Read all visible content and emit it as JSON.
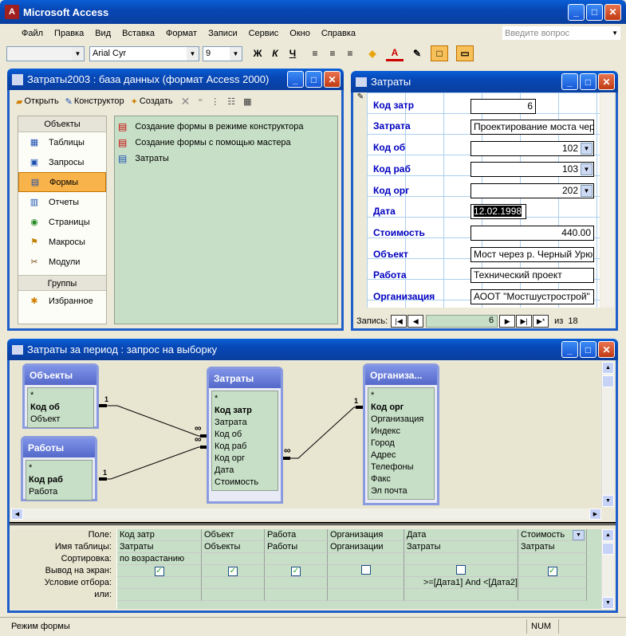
{
  "app": {
    "title": "Microsoft Access",
    "help_placeholder": "Введите вопрос",
    "status": "Режим формы",
    "num": "NUM"
  },
  "menu": [
    "Файл",
    "Правка",
    "Вид",
    "Вставка",
    "Формат",
    "Записи",
    "Сервис",
    "Окно",
    "Справка"
  ],
  "toolbar": {
    "font": "Arial Cyr",
    "size": "9"
  },
  "dbwin": {
    "title": "Затраты2003 : база данных (формат Access 2000)",
    "buttons": {
      "open": "Открыть",
      "design": "Конструктор",
      "create": "Создать"
    },
    "objects_header": "Объекты",
    "objects": [
      "Таблицы",
      "Запросы",
      "Формы",
      "Отчеты",
      "Страницы",
      "Макросы",
      "Модули"
    ],
    "groups_header": "Группы",
    "favorites": "Избранное",
    "items": [
      "Создание формы в режиме конструктора",
      "Создание формы с помощью мастера",
      "Затраты"
    ]
  },
  "form": {
    "title": "Затраты",
    "fields": [
      {
        "label": "Код затр",
        "value": "6",
        "num": true,
        "dd": false
      },
      {
        "label": "Затрата",
        "value": "Проектирование моста чер",
        "num": false,
        "dd": false
      },
      {
        "label": "Код об",
        "value": "102",
        "num": true,
        "dd": true
      },
      {
        "label": "Код раб",
        "value": "103",
        "num": true,
        "dd": true
      },
      {
        "label": "Код орг",
        "value": "202",
        "num": true,
        "dd": true
      },
      {
        "label": "Дата",
        "value": "12.02.1998",
        "num": false,
        "dd": false
      },
      {
        "label": "Стоимость",
        "value": "440.00",
        "num": true,
        "dd": false
      },
      {
        "label": "Объект",
        "value": "Мост через р. Черный Урю",
        "num": false,
        "dd": false
      },
      {
        "label": "Работа",
        "value": "Технический проект",
        "num": false,
        "dd": false
      },
      {
        "label": "Организация",
        "value": "АООТ \"Мостшустрострой\"",
        "num": false,
        "dd": false
      }
    ],
    "record_label": "Запись:",
    "record_current": "6",
    "record_of": "из",
    "record_total": "18"
  },
  "query": {
    "title": "Затраты за период : запрос на выборку",
    "tables": [
      {
        "name": "Объекты",
        "fields": [
          "*",
          "Код об",
          "Объект"
        ],
        "bold": "Код об"
      },
      {
        "name": "Работы",
        "fields": [
          "*",
          "Код раб",
          "Работа"
        ],
        "bold": "Код раб"
      },
      {
        "name": "Затраты",
        "fields": [
          "*",
          "Код затр",
          "Затрата",
          "Код об",
          "Код раб",
          "Код орг",
          "Дата",
          "Стоимость"
        ],
        "bold": "Код затр"
      },
      {
        "name": "Организа...",
        "fields": [
          "*",
          "Код орг",
          "Организация",
          "Индекс",
          "Город",
          "Адрес",
          "Телефоны",
          "Факс",
          "Эл почта"
        ],
        "bold": "Код орг"
      }
    ],
    "rel_one": "1",
    "rel_many": "∞",
    "row_labels": [
      "Поле:",
      "Имя таблицы:",
      "Сортировка:",
      "Вывод на экран:",
      "Условие отбора:",
      "или:"
    ],
    "columns": [
      {
        "field": "Код затр",
        "table": "Затраты",
        "sort": "по возрастанию",
        "show": true,
        "cond": ""
      },
      {
        "field": "Объект",
        "table": "Объекты",
        "sort": "",
        "show": true,
        "cond": ""
      },
      {
        "field": "Работа",
        "table": "Работы",
        "sort": "",
        "show": true,
        "cond": ""
      },
      {
        "field": "Организация",
        "table": "Организации",
        "sort": "",
        "show": false,
        "cond": ""
      },
      {
        "field": "Дата",
        "table": "Затраты",
        "sort": "",
        "show": false,
        "cond": ">=[Дата1] And <[Дата2]"
      },
      {
        "field": "Стоимость",
        "table": "Затраты",
        "sort": "",
        "show": true,
        "cond": ""
      }
    ]
  }
}
